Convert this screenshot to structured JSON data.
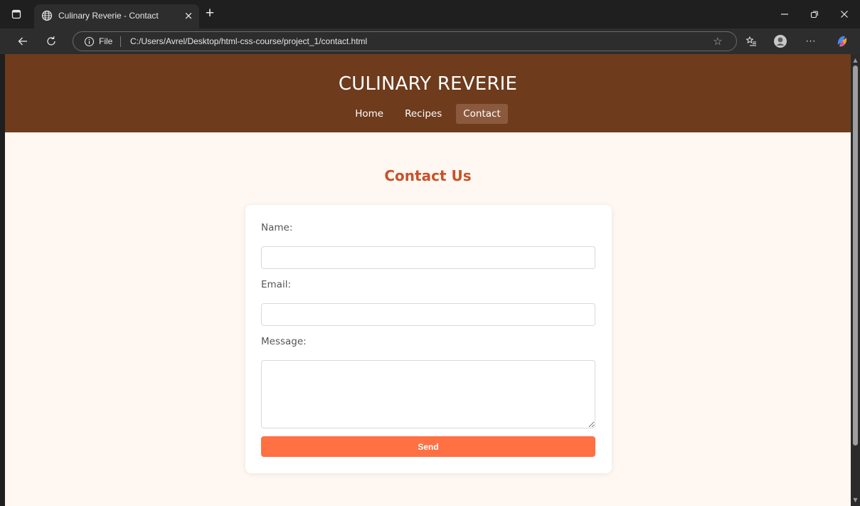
{
  "browser": {
    "tab_title": "Culinary Reverie - Contact",
    "tab_close": "×",
    "new_tab": "+",
    "omnibox_file_label": "File",
    "url": "C:/Users/Avrel/Desktop/html-css-course/project_1/contact.html",
    "star": "☆",
    "more_menu": "···"
  },
  "site": {
    "title": "CULINARY REVERIE",
    "nav": [
      {
        "label": "Home",
        "active": false
      },
      {
        "label": "Recipes",
        "active": false
      },
      {
        "label": "Contact",
        "active": true
      }
    ]
  },
  "contact": {
    "heading": "Contact Us",
    "name_label": "Name:",
    "name_value": "",
    "email_label": "Email:",
    "email_value": "",
    "message_label": "Message:",
    "message_value": "",
    "send_label": "Send"
  },
  "colors": {
    "header_bg": "#6e3b1c",
    "active_nav_bg": "#8b5a3e",
    "page_bg": "#fff7f1",
    "heading": "#c5532a",
    "button": "#ff7043"
  },
  "icons": {
    "sidebar_toggle": "sidebar-icon",
    "tab_favicon": "globe-icon",
    "back": "back-arrow-icon",
    "reload": "reload-icon",
    "info": "info-icon",
    "favorites": "favorites-icon",
    "profile": "profile-icon",
    "copilot": "copilot-icon"
  }
}
